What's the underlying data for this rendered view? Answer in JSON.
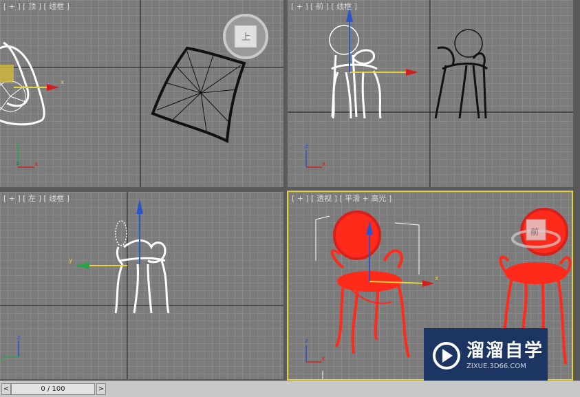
{
  "viewports": {
    "top": {
      "label": "[ + ] [ 顶 ] [ 线框 ]"
    },
    "front": {
      "label": "[ + ] [ 前 ] [ 线框 ]"
    },
    "left": {
      "label": "[ + ] [ 左 ] [ 线框 ]"
    },
    "perspective": {
      "label": "[ + ] [ 透视 ] [ 平滑 + 高光 ]"
    }
  },
  "viewcube": {
    "top_face": "上",
    "front_face": "前"
  },
  "axes": {
    "x": "x",
    "y": "y",
    "z": "z"
  },
  "timeline": {
    "prev": "<",
    "next": ">",
    "frame": "0 / 100"
  },
  "watermark": {
    "title": "溜溜自学",
    "subtitle": "ZIXUE.3D66.COM"
  },
  "colors": {
    "active_border": "#e7d23c",
    "chair_red": "#ff2a1a",
    "watermark_bg": "#1d3563"
  }
}
